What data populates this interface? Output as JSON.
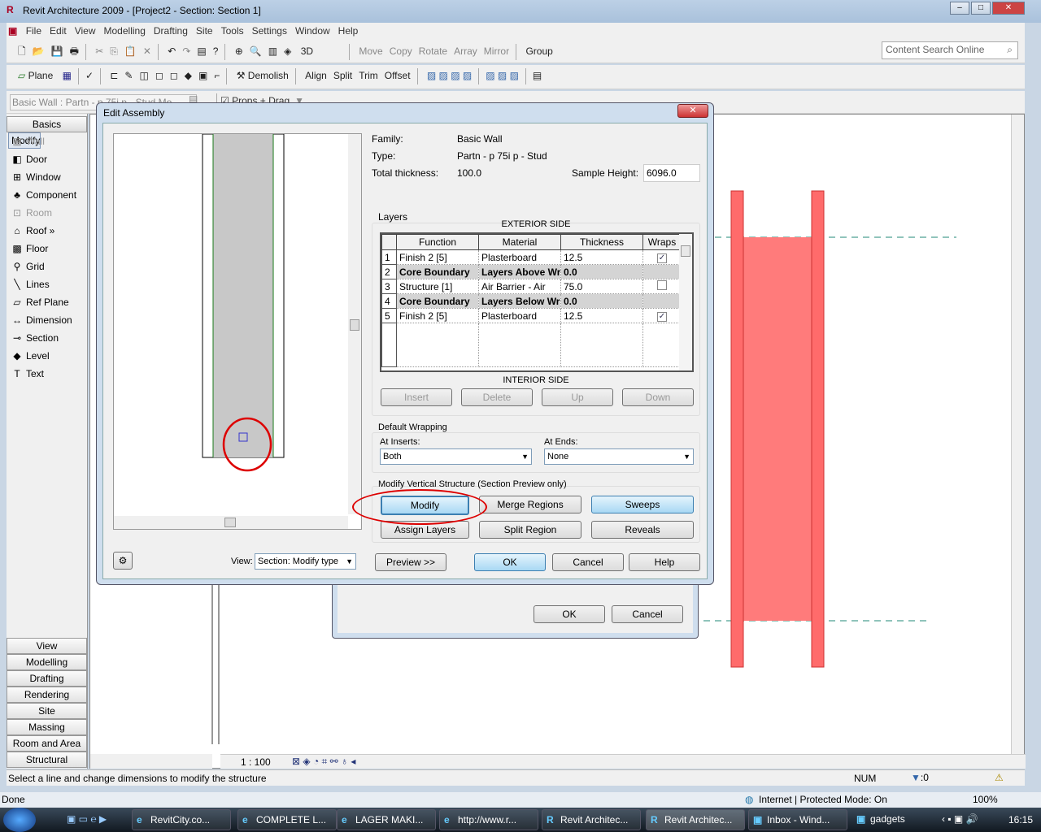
{
  "window": {
    "title": "Revit Architecture 2009 - [Project2 - Section: Section 1]"
  },
  "menu": [
    "File",
    "Edit",
    "View",
    "Modelling",
    "Drafting",
    "Site",
    "Tools",
    "Settings",
    "Window",
    "Help"
  ],
  "toolbar1": {
    "view3d": "3D",
    "move": "Move",
    "copy": "Copy",
    "rotate": "Rotate",
    "array": "Array",
    "mirror": "Mirror",
    "group": "Group",
    "search_placeholder": "Content Search Online"
  },
  "toolbar2": {
    "plane": "Plane",
    "demolish": "Demolish",
    "align": "Align",
    "split": "Split",
    "trim": "Trim",
    "offset": "Offset"
  },
  "type_selector": {
    "value": "Basic Wall : Partn - p 75i p - Stud Mo",
    "props_drag": "Props + Drag"
  },
  "sidebar": {
    "header": "Basics",
    "items": [
      {
        "label": "Modify",
        "icon": "↖"
      },
      {
        "label": "Wall",
        "icon": "▦"
      },
      {
        "label": "Door",
        "icon": "◧"
      },
      {
        "label": "Window",
        "icon": "⊞"
      },
      {
        "label": "Component",
        "icon": "♣"
      },
      {
        "label": "Room",
        "icon": "⊡"
      },
      {
        "label": "Roof »",
        "icon": "⌂"
      },
      {
        "label": "Floor",
        "icon": "▩"
      },
      {
        "label": "Grid",
        "icon": "⚲"
      },
      {
        "label": "Lines",
        "icon": "╲"
      },
      {
        "label": "Ref Plane",
        "icon": "▱"
      },
      {
        "label": "Dimension",
        "icon": "↔"
      },
      {
        "label": "Section",
        "icon": "⊸"
      },
      {
        "label": "Level",
        "icon": "◆"
      },
      {
        "label": "Text",
        "icon": "T"
      }
    ],
    "tabs": [
      "View",
      "Modelling",
      "Drafting",
      "Rendering",
      "Site",
      "Massing",
      "Room and Area",
      "Structural"
    ]
  },
  "view_bar": {
    "scale": "1 : 100"
  },
  "dialog": {
    "title": "Edit Assembly",
    "family_label": "Family:",
    "family": "Basic Wall",
    "type_label": "Type:",
    "type": "Partn - p 75i p - Stud",
    "thickness_label": "Total thickness:",
    "thickness": "100.0",
    "sample_height_label": "Sample Height:",
    "sample_height": "6096.0",
    "layers_label": "Layers",
    "exterior": "EXTERIOR SIDE",
    "interior": "INTERIOR SIDE",
    "columns": [
      "Function",
      "Material",
      "Thickness",
      "Wraps"
    ],
    "rows": [
      {
        "n": "1",
        "function": "Finish 2 [5]",
        "material": "Plasterboard",
        "thickness": "12.5",
        "wraps": true,
        "core": false
      },
      {
        "n": "2",
        "function": "Core Boundary",
        "material": "Layers Above Wr",
        "thickness": "0.0",
        "wraps": null,
        "core": true
      },
      {
        "n": "3",
        "function": "Structure [1]",
        "material": "Air Barrier - Air",
        "thickness": "75.0",
        "wraps": false,
        "core": false
      },
      {
        "n": "4",
        "function": "Core Boundary",
        "material": "Layers Below Wr",
        "thickness": "0.0",
        "wraps": null,
        "core": true
      },
      {
        "n": "5",
        "function": "Finish 2 [5]",
        "material": "Plasterboard",
        "thickness": "12.5",
        "wraps": true,
        "core": false
      }
    ],
    "insert": "Insert",
    "delete": "Delete",
    "up": "Up",
    "down": "Down",
    "default_wrapping": "Default Wrapping",
    "at_inserts_label": "At Inserts:",
    "at_inserts": "Both",
    "at_ends_label": "At Ends:",
    "at_ends": "None",
    "vertical_label": "Modify Vertical Structure (Section Preview only)",
    "modify": "Modify",
    "merge": "Merge Regions",
    "sweeps": "Sweeps",
    "assign": "Assign Layers",
    "split_region": "Split Region",
    "reveals": "Reveals",
    "view_label": "View:",
    "view_value": "Section: Modify type",
    "preview": "Preview >>",
    "ok": "OK",
    "cancel": "Cancel",
    "help": "Help"
  },
  "back_dialog": {
    "ok": "OK",
    "cancel": "Cancel"
  },
  "status": {
    "text": "Select a line and change dimensions to modify the structure",
    "num": "NUM",
    "filter": ":0"
  },
  "ie_status": {
    "done": "Done",
    "zone": "Internet | Protected Mode: On",
    "zoom": "100%"
  },
  "taskbar": {
    "items": [
      "RevitCity.co...",
      "COMPLETE L...",
      "LAGER MAKI...",
      "http://www.r...",
      "Revit Architec...",
      "Revit Architec...",
      "Inbox - Wind...",
      "gadgets"
    ],
    "clock": "16:15"
  }
}
